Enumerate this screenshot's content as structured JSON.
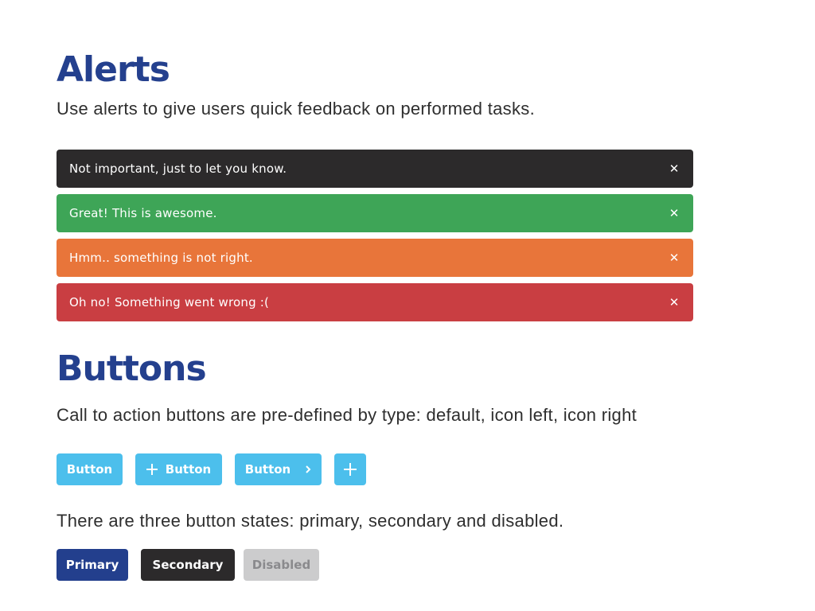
{
  "alerts_section": {
    "title": "Alerts",
    "description": "Use alerts to give users quick feedback on performed tasks.",
    "items": [
      {
        "text": "Not important, just to let you know.",
        "type": "info",
        "color": "#2c2a2b",
        "close_icon": "close-icon"
      },
      {
        "text": "Great! This is awesome.",
        "type": "success",
        "color": "#3ea557",
        "close_icon": "close-icon"
      },
      {
        "text": "Hmm.. something is not right.",
        "type": "warning",
        "color": "#e8753a",
        "close_icon": "close-icon"
      },
      {
        "text": "Oh no! Something went wrong :(",
        "type": "error",
        "color": "#c93e42",
        "close_icon": "close-icon"
      }
    ],
    "close_glyph": "✕"
  },
  "buttons_section": {
    "title": "Buttons",
    "description": "Call to action buttons are pre-defined by type: default, icon left, icon right",
    "cta_color": "#4cbfec",
    "cta_buttons": [
      {
        "label": "Button",
        "variant": "default"
      },
      {
        "label": "Button",
        "variant": "icon-left",
        "icon": "plus-icon"
      },
      {
        "label": "Button",
        "variant": "icon-right",
        "icon": "chevron-right-icon"
      },
      {
        "label": "",
        "variant": "icon-only",
        "icon": "plus-icon"
      }
    ],
    "states_description": "There are three button states: primary, secondary and disabled.",
    "state_buttons": [
      {
        "label": "Primary",
        "state": "primary",
        "color": "#233f8d"
      },
      {
        "label": "Secondary",
        "state": "secondary",
        "color": "#2c2a2b"
      },
      {
        "label": "Disabled",
        "state": "disabled",
        "color": "#cccccd"
      }
    ]
  },
  "heading_color": "#24408e"
}
